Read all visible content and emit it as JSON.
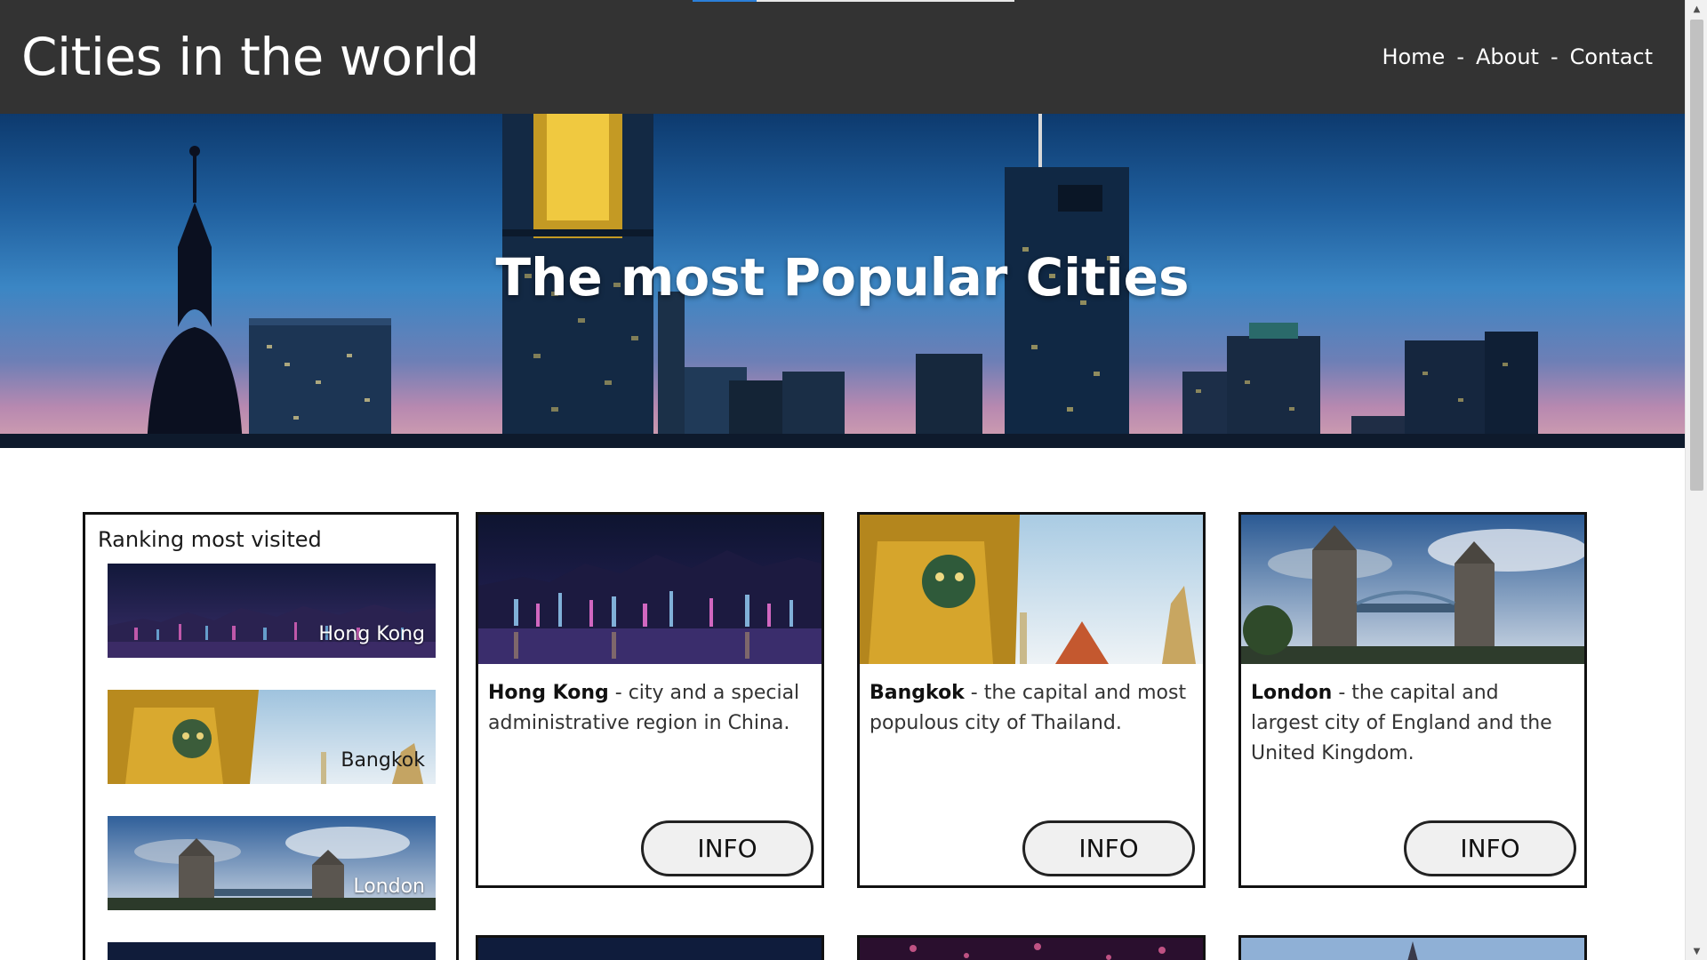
{
  "header": {
    "title": "Cities in the world",
    "nav": [
      {
        "label": "Home"
      },
      {
        "label": "About"
      },
      {
        "label": "Contact"
      }
    ],
    "separator": "-",
    "background": "#333333"
  },
  "top_progress": {
    "fraction": 0.2,
    "color": "#2b7fd9"
  },
  "hero": {
    "title": "The most Popular Cities"
  },
  "ranking": {
    "title": "Ranking most visited",
    "items": [
      {
        "label": "Hong Kong"
      },
      {
        "label": "Bangkok"
      },
      {
        "label": "London"
      }
    ]
  },
  "cards": [
    {
      "name": "Hong Kong",
      "description": " - city and a special administrative region in China.",
      "button": "INFO"
    },
    {
      "name": "Bangkok",
      "description": " - the capital and most populous city of Thailand.",
      "button": "INFO"
    },
    {
      "name": "London",
      "description": " - the capital and largest city of England and the United Kingdom.",
      "button": "INFO"
    }
  ],
  "icons": {
    "scroll_up": "scroll-up-arrow-icon",
    "scroll_down": "scroll-down-arrow-icon"
  }
}
